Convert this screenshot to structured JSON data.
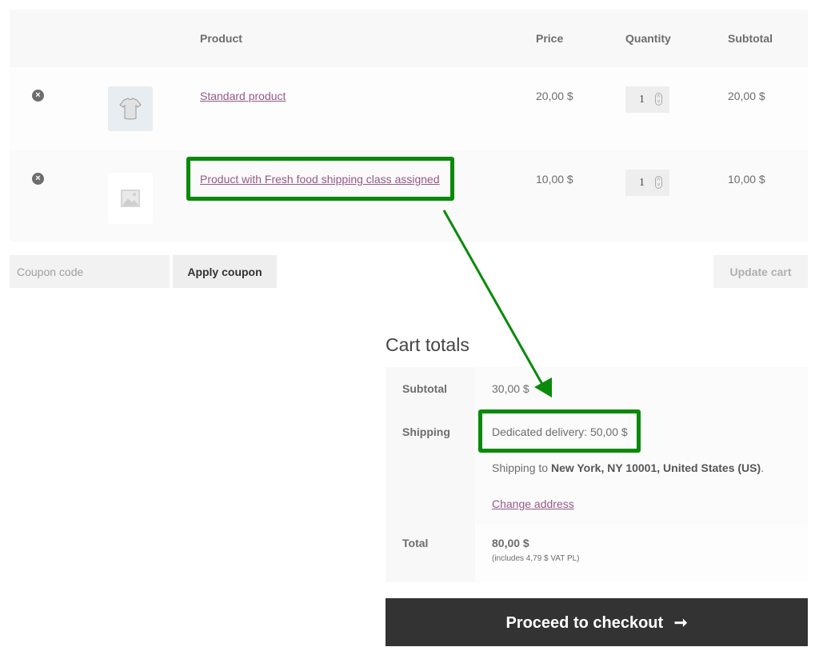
{
  "cart": {
    "headers": {
      "product": "Product",
      "price": "Price",
      "quantity": "Quantity",
      "subtotal": "Subtotal"
    },
    "items": [
      {
        "name": "Standard product",
        "price": "20,00 $",
        "quantity": "1",
        "subtotal": "20,00 $",
        "thumbnail": "tshirt-image",
        "remove_icon": "×"
      },
      {
        "name": "Product with Fresh food shipping class assigned",
        "price": "10,00 $",
        "quantity": "1",
        "subtotal": "10,00 $",
        "thumbnail": "placeholder-image",
        "remove_icon": "×"
      }
    ],
    "coupon": {
      "placeholder": "Coupon code",
      "value": "",
      "apply_label": "Apply coupon"
    },
    "update_label": "Update cart"
  },
  "totals": {
    "title": "Cart totals",
    "subtotal_label": "Subtotal",
    "subtotal_value": "30,00 $",
    "shipping_label": "Shipping",
    "shipping_method": "Dedicated delivery: 50,00 $",
    "shipping_to_prefix": "Shipping to",
    "shipping_destination": "New York, NY 10001, United States (US)",
    "shipping_to_suffix": ".",
    "change_address": "Change address",
    "total_label": "Total",
    "total_value": "80,00 $",
    "tax_note": "(includes 4,79 $ VAT PL)"
  },
  "checkout": {
    "label": "Proceed to checkout",
    "arrow": "➞"
  },
  "annotation": {
    "color": "#0a8a0a",
    "accent_link": "#96588a"
  }
}
